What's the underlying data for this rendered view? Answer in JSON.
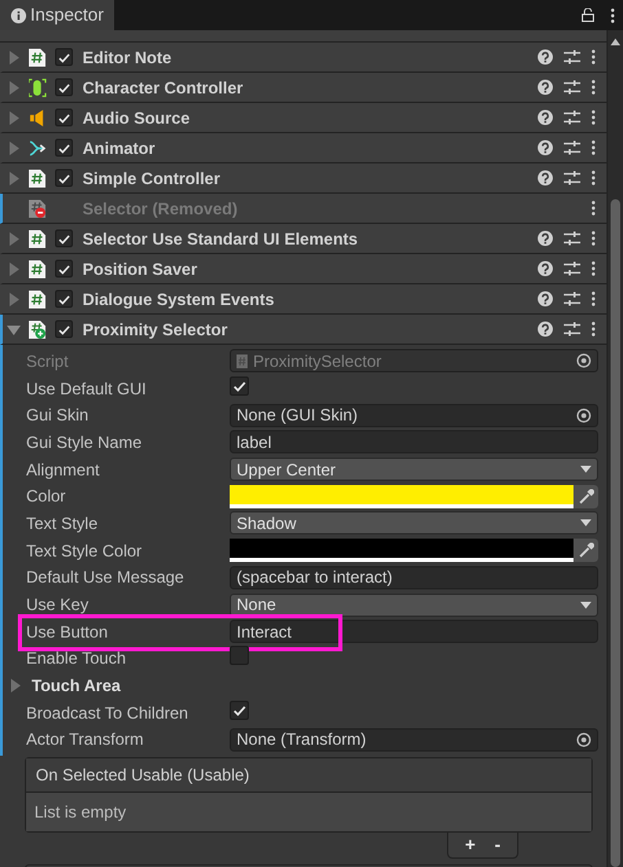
{
  "tab": {
    "title": "Inspector"
  },
  "components": [
    {
      "name": "Editor Note",
      "kind": "script",
      "enabled": true,
      "expanded": false,
      "removed": false
    },
    {
      "name": "Character Controller",
      "kind": "capsule",
      "enabled": true,
      "expanded": false,
      "removed": false
    },
    {
      "name": "Audio Source",
      "kind": "speaker",
      "enabled": true,
      "expanded": false,
      "removed": false
    },
    {
      "name": "Animator",
      "kind": "branch",
      "enabled": true,
      "expanded": false,
      "removed": false
    },
    {
      "name": "Simple Controller",
      "kind": "script",
      "enabled": true,
      "expanded": false,
      "removed": false
    },
    {
      "name": "Selector (Removed)",
      "kind": "script-minus",
      "removed": true
    },
    {
      "name": "Selector Use Standard UI Elements",
      "kind": "script",
      "enabled": true,
      "expanded": false,
      "removed": false
    },
    {
      "name": "Position Saver",
      "kind": "script",
      "enabled": true,
      "expanded": false,
      "removed": false
    },
    {
      "name": "Dialogue System Events",
      "kind": "script",
      "enabled": true,
      "expanded": false,
      "removed": false
    },
    {
      "name": "Proximity Selector",
      "kind": "script-plus",
      "enabled": true,
      "expanded": true,
      "removed": false
    }
  ],
  "properties": [
    {
      "kind": "object",
      "label": "Script",
      "value": "ProximitySelector",
      "disabled": true,
      "highlighted": false
    },
    {
      "kind": "toggle",
      "label": "Use Default GUI",
      "checked": true,
      "disabled": false,
      "highlighted": false
    },
    {
      "kind": "object",
      "label": "Gui Skin",
      "value": "None (GUI Skin)",
      "disabled": false,
      "highlighted": false
    },
    {
      "kind": "text",
      "label": "Gui Style Name",
      "value": "label",
      "disabled": false,
      "highlighted": false
    },
    {
      "kind": "dropdown",
      "label": "Alignment",
      "value": "Upper Center",
      "disabled": false,
      "highlighted": false
    },
    {
      "kind": "color",
      "label": "Color",
      "color": "#ffee00",
      "disabled": false,
      "highlighted": false
    },
    {
      "kind": "dropdown",
      "label": "Text Style",
      "value": "Shadow",
      "disabled": false,
      "highlighted": false
    },
    {
      "kind": "color",
      "label": "Text Style Color",
      "color": "#000000",
      "disabled": false,
      "highlighted": false
    },
    {
      "kind": "text",
      "label": "Default Use Message",
      "value": "(spacebar to interact)",
      "disabled": false,
      "highlighted": false
    },
    {
      "kind": "dropdown",
      "label": "Use Key",
      "value": "None",
      "disabled": false,
      "highlighted": false
    },
    {
      "kind": "text",
      "label": "Use Button",
      "value": "Interact",
      "disabled": false,
      "highlighted": true
    },
    {
      "kind": "toggle",
      "label": "Enable Touch",
      "checked": false,
      "disabled": false,
      "highlighted": false
    },
    {
      "kind": "foldout",
      "label": "Touch Area",
      "expanded": false,
      "disabled": false,
      "highlighted": false
    },
    {
      "kind": "toggle",
      "label": "Broadcast To Children",
      "checked": true,
      "disabled": false,
      "highlighted": false
    },
    {
      "kind": "object",
      "label": "Actor Transform",
      "value": "None (Transform)",
      "disabled": false,
      "highlighted": false
    }
  ],
  "event_list": {
    "header": "On Selected Usable (Usable)",
    "empty_text": "List is empty",
    "buttons": [
      "+",
      "-"
    ]
  }
}
